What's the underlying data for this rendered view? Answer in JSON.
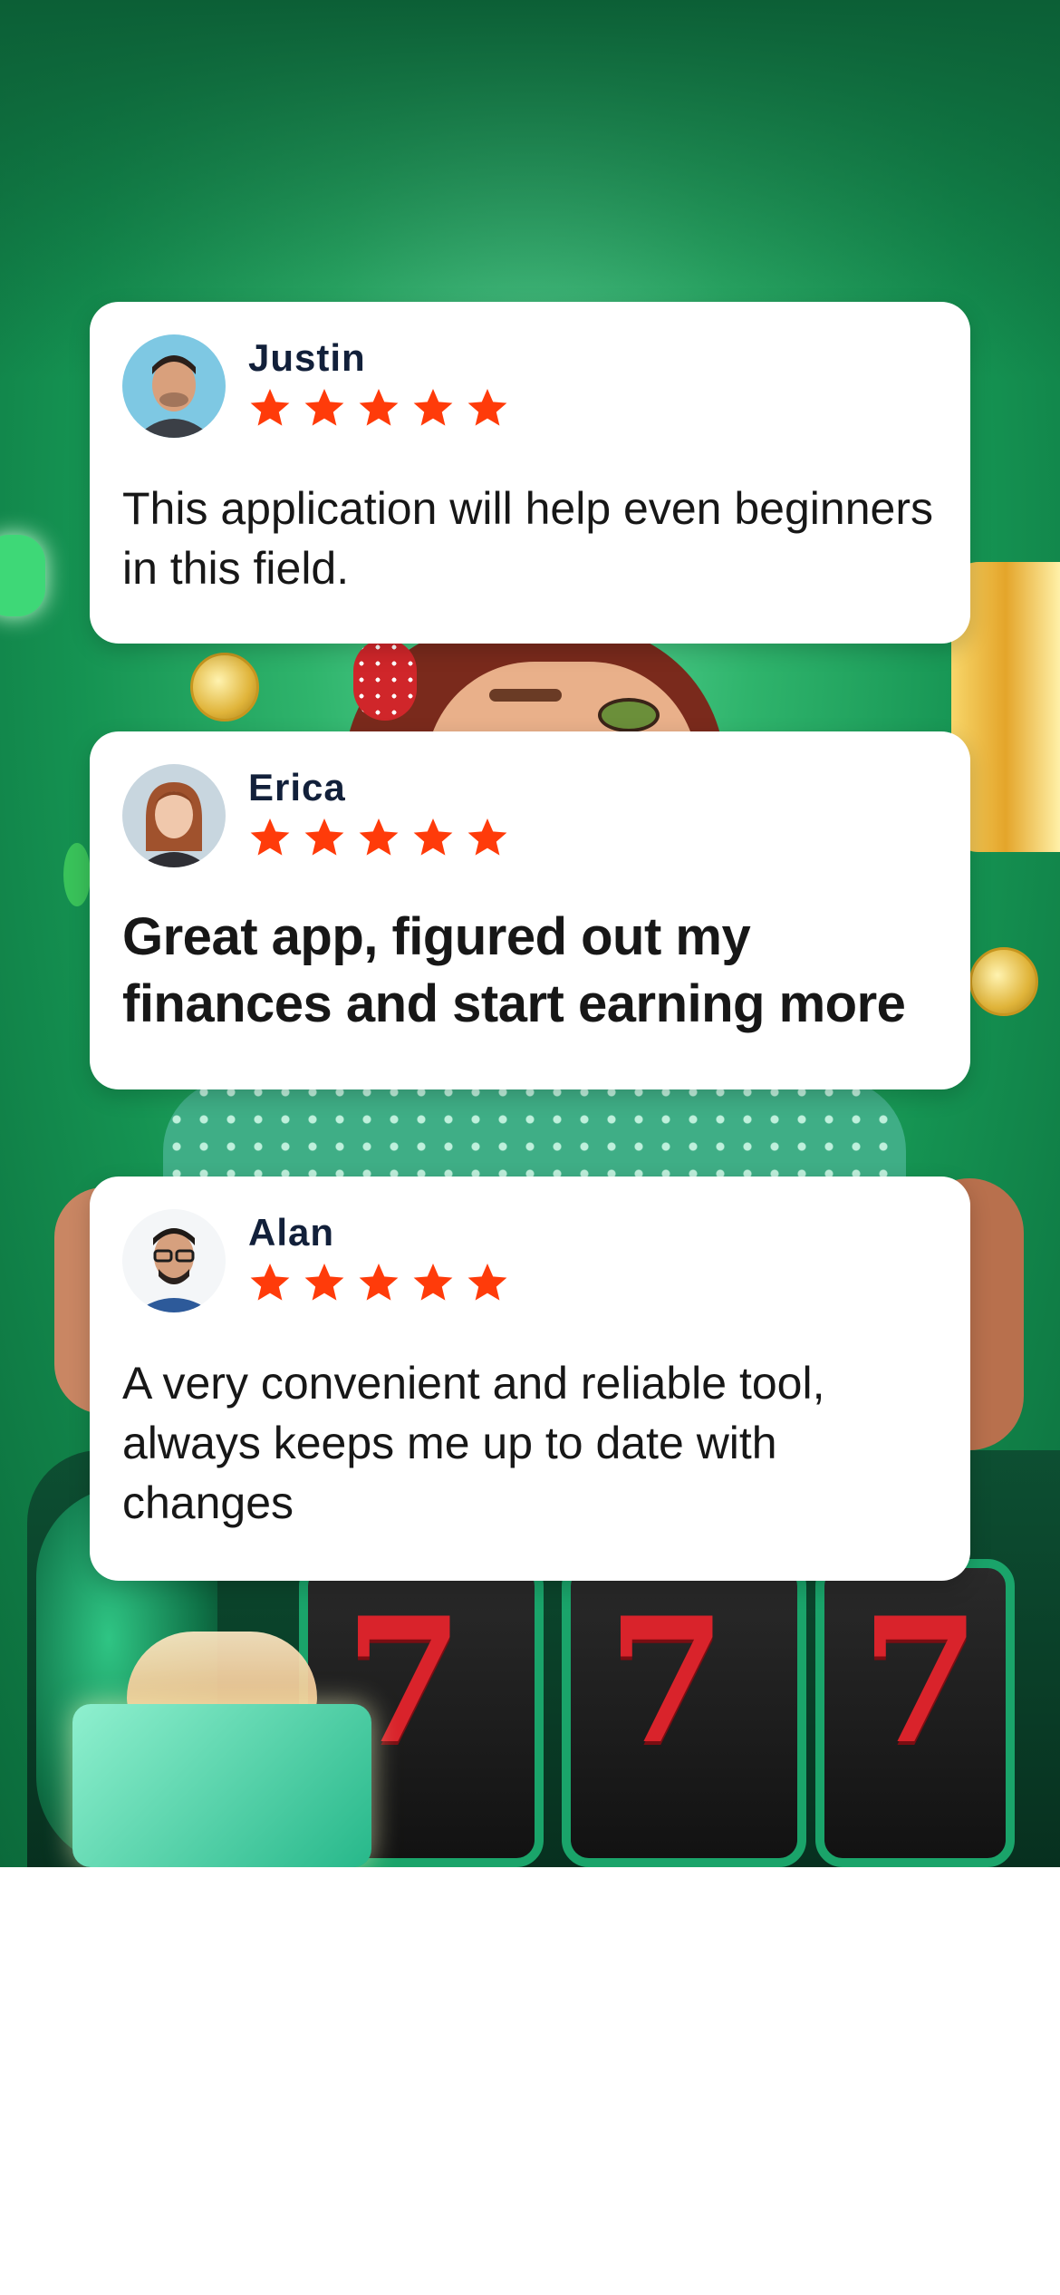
{
  "reviews": [
    {
      "name": "Justin",
      "rating": 5,
      "text": "This application will help even beginners in this field."
    },
    {
      "name": "Erica",
      "rating": 5,
      "text": "Great app, figured out my finances and start earning more"
    },
    {
      "name": "Alan",
      "rating": 5,
      "text": "A very convenient and reliable tool, always keeps me up to date with changes"
    }
  ],
  "colors": {
    "star": "#ff3b0a",
    "name": "#12203a",
    "card_bg": "#ffffff",
    "hero_green": "#2fb46c"
  },
  "icons": {
    "star": "star-icon",
    "avatar": "avatar"
  }
}
